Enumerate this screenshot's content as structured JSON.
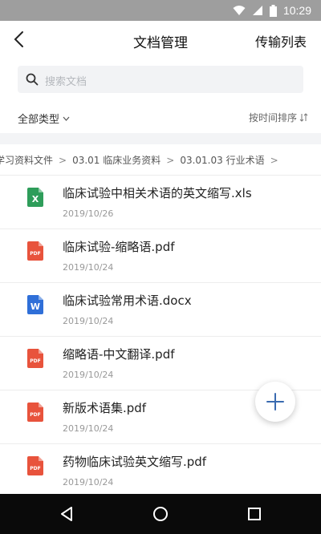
{
  "status_bar": {
    "time": "10:29",
    "icons": [
      "wifi-icon",
      "signal-icon",
      "battery-icon"
    ],
    "background": "#9e9e9e"
  },
  "nav": {
    "title": "文档管理",
    "right_action": "传输列表",
    "back_icon": "back-chevron-icon"
  },
  "search": {
    "placeholder": "搜索文档",
    "icon": "search-icon"
  },
  "filters": {
    "type_label": "全部类型",
    "type_icon": "chevron-down-icon",
    "sort_label": "按时间排序",
    "sort_icon": "sort-icon"
  },
  "breadcrumb": {
    "items": [
      "学习资料文件",
      "03.01 临床业务资料",
      "03.01.03 行业术语"
    ],
    "separator": ">"
  },
  "files": [
    {
      "name": "临床试验中相关术语的英文缩写.xls",
      "date": "2019/10/26",
      "type": "xls"
    },
    {
      "name": "临床试验-缩略语.pdf",
      "date": "2019/10/24",
      "type": "pdf"
    },
    {
      "name": "临床试验常用术语.docx",
      "date": "2019/10/24",
      "type": "docx"
    },
    {
      "name": "缩略语-中文翻译.pdf",
      "date": "2019/10/24",
      "type": "pdf"
    },
    {
      "name": "新版术语集.pdf",
      "date": "2019/10/24",
      "type": "pdf"
    },
    {
      "name": "药物临床试验英文缩写.pdf",
      "date": "2019/10/24",
      "type": "pdf"
    }
  ],
  "file_type_icons": {
    "xls": {
      "color": "#2e9d5a",
      "glyph": "X"
    },
    "pdf": {
      "color": "#e8533c",
      "glyph": "PDF"
    },
    "docx": {
      "color": "#2f6fd8",
      "glyph": "W"
    }
  },
  "fab": {
    "icon": "plus-icon",
    "color": "#3a6ab0"
  },
  "system_nav": {
    "buttons": [
      "back-triangle-icon",
      "home-circle-icon",
      "recents-square-icon"
    ]
  }
}
